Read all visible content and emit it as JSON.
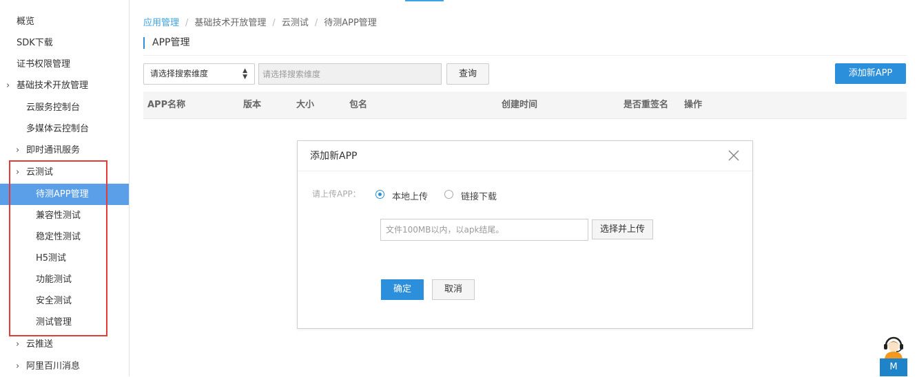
{
  "sidebar": {
    "items": [
      {
        "label": "概览"
      },
      {
        "label": "SDK下载"
      },
      {
        "label": "证书权限管理"
      },
      {
        "label": "基础技术开放管理"
      },
      {
        "label": "云服务控制台"
      },
      {
        "label": "多媒体云控制台"
      },
      {
        "label": "即时通讯服务"
      },
      {
        "label": "云测试"
      },
      {
        "label": "待测APP管理"
      },
      {
        "label": "兼容性测试"
      },
      {
        "label": "稳定性测试"
      },
      {
        "label": "H5测试"
      },
      {
        "label": "功能测试"
      },
      {
        "label": "安全测试"
      },
      {
        "label": "测试管理"
      },
      {
        "label": "云推送"
      },
      {
        "label": "阿里百川消息"
      }
    ],
    "active_item": "待测APP管理",
    "highlight_color": "#e53935"
  },
  "breadcrumb": {
    "items": [
      "应用管理",
      "基础技术开放管理",
      "云测试",
      "待测APP管理"
    ],
    "separator": "/"
  },
  "page": {
    "title": "APP管理"
  },
  "toolbar": {
    "select_value": "请选择搜索维度",
    "search_placeholder": "请选择搜索维度",
    "query_label": "查询",
    "add_label": "添加新APP"
  },
  "table": {
    "columns": [
      "APP名称",
      "版本",
      "大小",
      "包名",
      "创建时间",
      "是否重签名",
      "操作"
    ]
  },
  "modal": {
    "title": "添加新APP",
    "upload_label": "请上传APP：",
    "radio_local": "本地上传",
    "radio_link": "链接下载",
    "selected_option": "本地上传",
    "file_placeholder": "文件100MB以内，以apk结尾。",
    "choose_label": "选择并上传",
    "ok_label": "确定",
    "cancel_label": "取消"
  },
  "support": {
    "tab_label": "M"
  },
  "colors": {
    "accent": "#2b8fdc",
    "active_nav": "#5b9fe8",
    "link": "#39a3e6"
  }
}
